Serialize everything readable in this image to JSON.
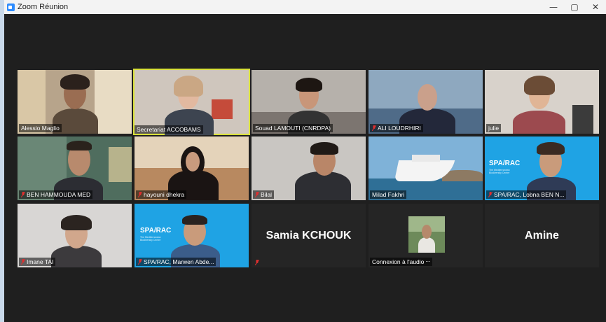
{
  "window": {
    "title": "Zoom Réunion",
    "controls": [
      "—",
      "▢",
      "✕"
    ]
  },
  "participants": [
    {
      "name": "Alessio Maglio",
      "muted": false
    },
    {
      "name": "Secretariat ACCOBAMS",
      "muted": false,
      "active_speaker": true
    },
    {
      "name": "Souad LAMOUTI (CNRDPA)",
      "muted": false
    },
    {
      "name": "ALI LOUDRHIRI",
      "muted": true
    },
    {
      "name": "julie",
      "muted": false
    },
    {
      "name": "BEN HAMMOUDA MED",
      "muted": true
    },
    {
      "name": "hayouni dhekra",
      "muted": true
    },
    {
      "name": "Bilal",
      "muted": true
    },
    {
      "name": "Milad Fakhri",
      "muted": false
    },
    {
      "name": "SPA/RAC, Lobna BEN N...",
      "muted": true
    },
    {
      "name": "Imane TAI",
      "muted": true
    },
    {
      "name": "SPA/RAC, Marwen Abde...",
      "muted": true
    },
    {
      "name": "Samia KCHOUK",
      "muted": true,
      "video_off": true
    },
    {
      "name": "Connexion à l'audio",
      "muted": false,
      "audio_connecting": true
    },
    {
      "name": "Amine",
      "muted": false,
      "video_off": true
    }
  ],
  "spa_logo": {
    "main": "SPA/RAC",
    "sub": "The Mediterranean Biodiversity Centre"
  },
  "colors": {
    "active_border": "#d8e03a",
    "mute_red": "#e02f2f",
    "spa_blue": "#1fa3e4"
  }
}
